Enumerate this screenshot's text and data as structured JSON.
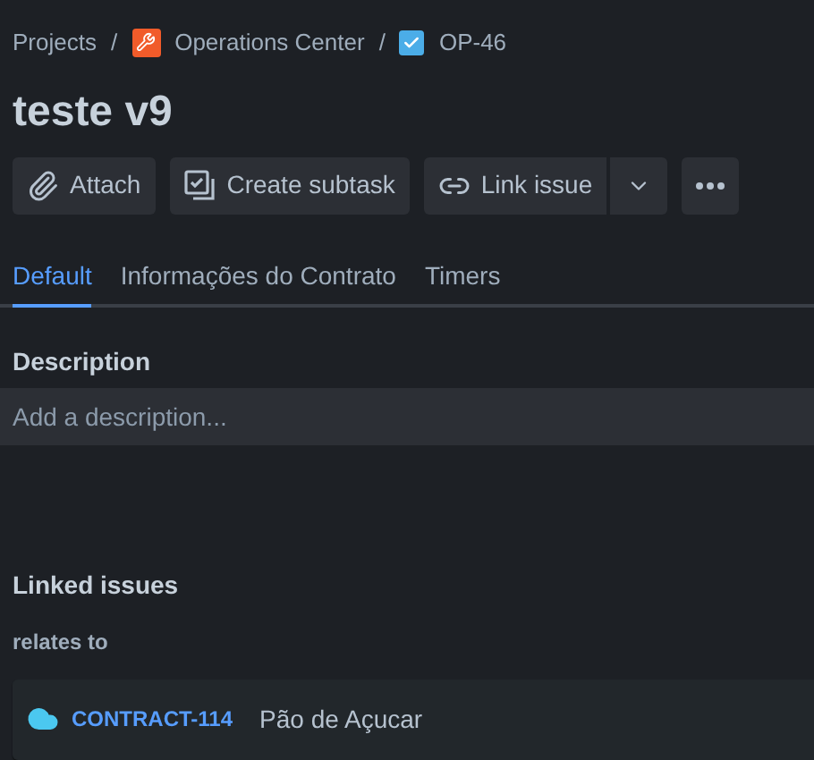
{
  "breadcrumbs": [
    {
      "kind": "text",
      "label": "Projects"
    },
    {
      "kind": "project",
      "separator": "/",
      "label": "Operations Center"
    },
    {
      "kind": "issue",
      "separator": "/",
      "label": "OP-46"
    }
  ],
  "title": "teste v9",
  "actions": [
    {
      "kind": "attach",
      "label": "Attach"
    },
    {
      "kind": "subtask",
      "label": "Create subtask"
    },
    {
      "kind": "link",
      "label": "Link issue"
    }
  ],
  "tabs": [
    {
      "label": "Default",
      "selected": true
    },
    {
      "label": "Informações do Contrato",
      "selected": false
    },
    {
      "label": "Timers",
      "selected": false
    }
  ],
  "description": {
    "label": "Description",
    "placeholder": "Add a description..."
  },
  "linked_issues": {
    "title": "Linked issues",
    "relation": "relates to",
    "items": [
      {
        "key": "CONTRACT-114",
        "summary": "Pão de Açucar"
      }
    ]
  }
}
